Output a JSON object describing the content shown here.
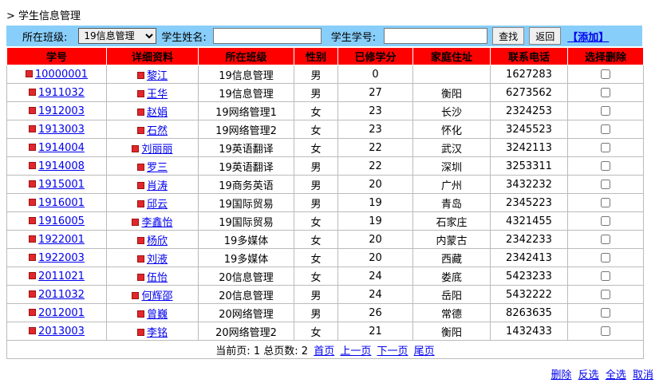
{
  "page_title": "> 学生信息管理",
  "toolbar": {
    "class_label": "所在班级:",
    "class_selected": "19信息管理",
    "name_label": "学生姓名:",
    "name_value": "",
    "no_label": "学生学号:",
    "no_value": "",
    "find_label": "查找",
    "back_label": "返回",
    "add_label": "【添加】"
  },
  "columns": [
    "学号",
    "详细资料",
    "所在班级",
    "性别",
    "已修学分",
    "家庭住址",
    "联系电话",
    "选择删除"
  ],
  "rows": [
    {
      "id": "10000001",
      "name": "黎江",
      "class": "19信息管理",
      "gender": "男",
      "credits": "0",
      "address": "",
      "phone": "1627283"
    },
    {
      "id": "1911032",
      "name": "王华",
      "class": "19信息管理",
      "gender": "男",
      "credits": "27",
      "address": "衡阳",
      "phone": "6273562"
    },
    {
      "id": "1912003",
      "name": "赵娟",
      "class": "19网络管理1",
      "gender": "女",
      "credits": "23",
      "address": "长沙",
      "phone": "2324253"
    },
    {
      "id": "1913003",
      "name": "石然",
      "class": "19网络管理2",
      "gender": "女",
      "credits": "23",
      "address": "怀化",
      "phone": "3245523"
    },
    {
      "id": "1914004",
      "name": "刘丽丽",
      "class": "19英语翻译",
      "gender": "女",
      "credits": "22",
      "address": "武汉",
      "phone": "3242113"
    },
    {
      "id": "1914008",
      "name": "罗三",
      "class": "19英语翻译",
      "gender": "男",
      "credits": "22",
      "address": "深圳",
      "phone": "3253311"
    },
    {
      "id": "1915001",
      "name": "肖涛",
      "class": "19商务英语",
      "gender": "男",
      "credits": "20",
      "address": "广州",
      "phone": "3432232"
    },
    {
      "id": "1916001",
      "name": "邱云",
      "class": "19国际贸易",
      "gender": "男",
      "credits": "19",
      "address": "青岛",
      "phone": "2345223"
    },
    {
      "id": "1916005",
      "name": "李鑫怡",
      "class": "19国际贸易",
      "gender": "女",
      "credits": "19",
      "address": "石家庄",
      "phone": "4321455"
    },
    {
      "id": "1922001",
      "name": "杨欣",
      "class": "19多媒体",
      "gender": "女",
      "credits": "20",
      "address": "内蒙古",
      "phone": "2342233"
    },
    {
      "id": "1922003",
      "name": "刘液",
      "class": "19多媒体",
      "gender": "女",
      "credits": "20",
      "address": "西藏",
      "phone": "2342413"
    },
    {
      "id": "2011021",
      "name": "伍怡",
      "class": "20信息管理",
      "gender": "女",
      "credits": "24",
      "address": "娄底",
      "phone": "5423233"
    },
    {
      "id": "2011032",
      "name": "何辉邵",
      "class": "20信息管理",
      "gender": "男",
      "credits": "24",
      "address": "岳阳",
      "phone": "5432222"
    },
    {
      "id": "2012001",
      "name": "曾巍",
      "class": "20网络管理",
      "gender": "男",
      "credits": "26",
      "address": "常德",
      "phone": "8263635"
    },
    {
      "id": "2013003",
      "name": "李铭",
      "class": "20网络管理2",
      "gender": "女",
      "credits": "21",
      "address": "衡阳",
      "phone": "1432433"
    }
  ],
  "pager": {
    "current_label": "当前页:",
    "current": "1",
    "total_label": "总页数:",
    "total": "2",
    "first": "首页",
    "prev": "上一页",
    "next": "下一页",
    "last": "尾页"
  },
  "bottom": {
    "delete": "删除",
    "invert": "反选",
    "select_all": "全选",
    "cancel": "取消"
  },
  "colors": {
    "toolbar_bg": "#87cefa",
    "header_bg": "#ff0000",
    "link": "#0000ee"
  }
}
